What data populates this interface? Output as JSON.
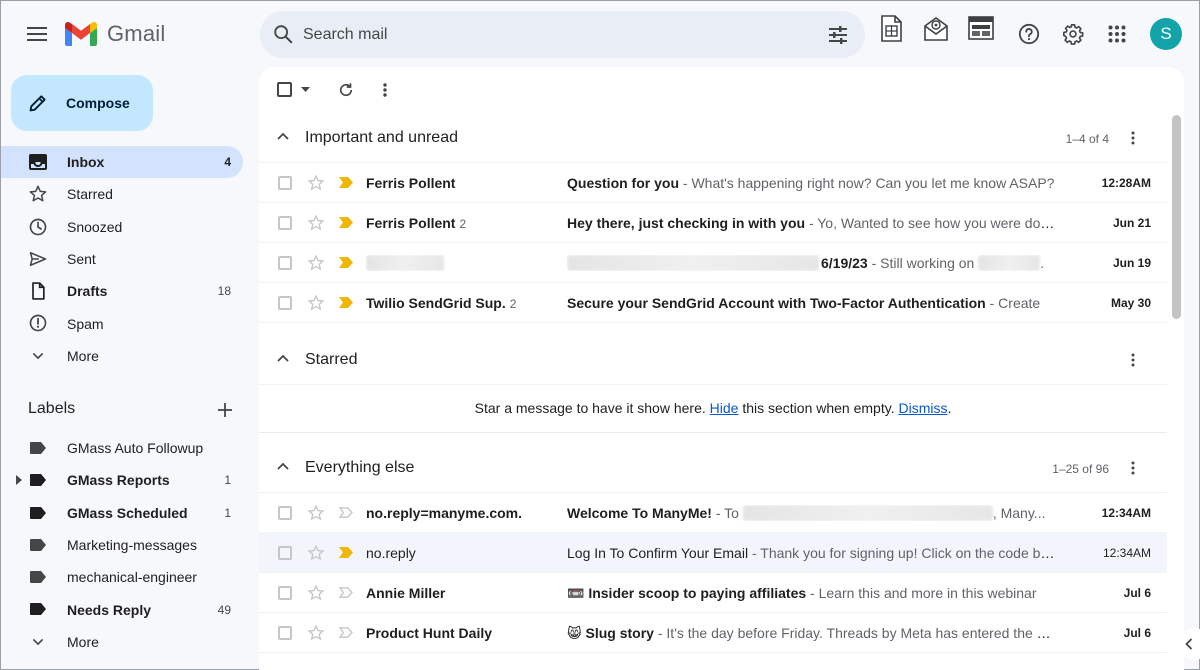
{
  "app": {
    "name": "Gmail"
  },
  "search": {
    "placeholder": "Search mail"
  },
  "user": {
    "avatar_letter": "S",
    "avatar_color": "#12a4a8"
  },
  "compose": {
    "label": "Compose"
  },
  "nav": [
    {
      "label": "Inbox",
      "count": "4",
      "icon": "inbox-icon",
      "active": true
    },
    {
      "label": "Starred",
      "count": "",
      "icon": "star-icon"
    },
    {
      "label": "Snoozed",
      "count": "",
      "icon": "clock-icon"
    },
    {
      "label": "Sent",
      "count": "",
      "icon": "send-icon"
    },
    {
      "label": "Drafts",
      "count": "18",
      "icon": "draft-icon"
    },
    {
      "label": "Spam",
      "count": "",
      "icon": "spam-icon"
    },
    {
      "label": "More",
      "count": "",
      "icon": "chevron-down-icon"
    }
  ],
  "labels_section": {
    "title": "Labels",
    "items": [
      {
        "label": "GMass Auto Followup",
        "count": ""
      },
      {
        "label": "GMass Reports",
        "count": "1"
      },
      {
        "label": "GMass Scheduled",
        "count": "1"
      },
      {
        "label": "Marketing-messages",
        "count": ""
      },
      {
        "label": "mechanical-engineer",
        "count": ""
      },
      {
        "label": "Needs Reply",
        "count": "49"
      },
      {
        "label": "More",
        "count": ""
      }
    ]
  },
  "sections": {
    "important": {
      "title": "Important and unread",
      "range": "1–4 of 4",
      "rows": [
        {
          "sender": "Ferris Pollent",
          "count": "",
          "subject": "Question for you",
          "snippet": " - What's happening right now? Can you let me know ASAP?",
          "date": "12:28AM"
        },
        {
          "sender": "Ferris Pollent",
          "count": "2",
          "subject": "Hey there, just checking in with you",
          "snippet": " - Yo, Wanted to see how you were doing",
          "date": "Jun 21"
        },
        {
          "sender": "",
          "count": "",
          "subject": "6/19/23",
          "snippet": " - Still working on",
          "snippet_end": ".",
          "date": "Jun 19"
        },
        {
          "sender": "Twilio SendGrid Sup.",
          "count": "2",
          "subject": "Secure your SendGrid Account with Two-Factor Authentication",
          "snippet": " - Create",
          "date": "May 30"
        }
      ]
    },
    "starred": {
      "title": "Starred",
      "empty_text_1": "Star a message to have it show here. ",
      "hide_link": "Hide",
      "empty_text_2": " this section when empty. ",
      "dismiss_link": "Dismiss",
      "empty_text_3": "."
    },
    "everything": {
      "title": "Everything else",
      "range": "1–25 of 96",
      "rows": [
        {
          "sender": "no.reply=manyme.com.",
          "count": "",
          "subject": "Welcome To ManyMe!",
          "snippet_prefix": " - To",
          "snippet": ", Many...",
          "date": "12:34AM"
        },
        {
          "sender": "no.reply",
          "count": "",
          "subject": "Log In To Confirm Your Email",
          "snippet": " - Thank you for signing up! Click on the code below",
          "date": "12:34AM"
        },
        {
          "sender": "Annie Miller",
          "count": "",
          "emoji": "📼",
          "subject": "Insider scoop to paying affiliates",
          "snippet": " - Learn this and more in this webinar",
          "date": "Jul 6"
        },
        {
          "sender": "Product Hunt Daily",
          "count": "",
          "emoji": "😸",
          "subject": "Slug story",
          "snippet": " - It's the day before Friday. Threads by Meta has entered the chat",
          "date": "Jul 6"
        }
      ]
    }
  },
  "colors": {
    "accent": "#0b57d0",
    "compose_bg": "#c2e7ff",
    "active_nav": "#d3e3fd",
    "important_marker": "#f2b600"
  }
}
